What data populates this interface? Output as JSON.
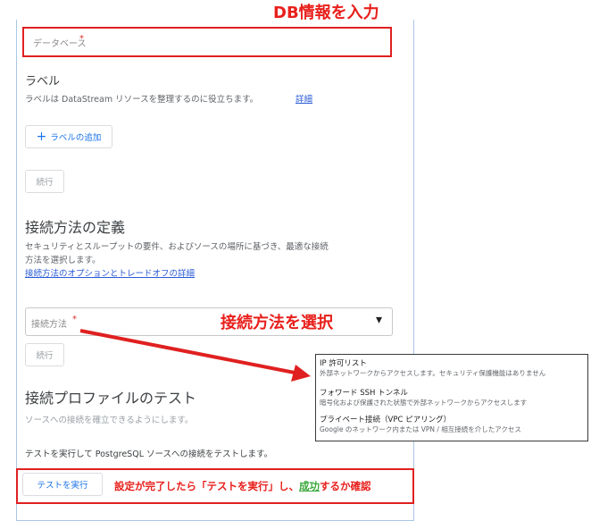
{
  "annotations": {
    "db_info": "DB情報を入力",
    "select_method": "接続方法を選択",
    "run_test_prefix": "設定が完了したら「テストを実行」し、",
    "run_test_success": "成功",
    "run_test_suffix": "するか確認"
  },
  "database_field": {
    "placeholder": "データベース",
    "required_mark": "*"
  },
  "labels_section": {
    "title": "ラベル",
    "description": "ラベルは DataStream リソースを整理するのに役立ちます。",
    "details_link": "詳細",
    "add_label_button": "ラベルの追加",
    "add_icon": "+"
  },
  "continue_button_1": "続行",
  "connection_method_section": {
    "title": "接続方法の定義",
    "description_line1": "セキュリティとスループットの要件、およびソースの場所に基づき、最適な接続",
    "description_line2": "方法を選択します。",
    "link": "接続方法のオプションとトレードオフの詳細",
    "select_placeholder": "接続方法",
    "required_mark": "*",
    "dropdown_arrow": "▾"
  },
  "dropdown_options": [
    {
      "title": "IP 許可リスト",
      "description": "外部ネットワークからアクセスします。セキュリティ保護機能はありません"
    },
    {
      "title": "フォワード SSH トンネル",
      "description": "暗号化および保護された状態で外部ネットワークからアクセスします"
    },
    {
      "title": "プライベート接続（VPC ピアリング）",
      "description": "Google のネットワーク内または VPN / 相互接続を介したアクセス"
    }
  ],
  "continue_button_2": "続行",
  "test_section": {
    "title": "接続プロファイルのテスト",
    "subtitle": "ソースへの接続を確立できるようにします。",
    "description": "テストを実行して PostgreSQL ソースへの接続をテストします。",
    "run_test_button": "テストを実行"
  },
  "colors": {
    "annotation_red": "#e8201c",
    "success_green": "#3aa83a",
    "link_blue": "#2a5bd7"
  }
}
